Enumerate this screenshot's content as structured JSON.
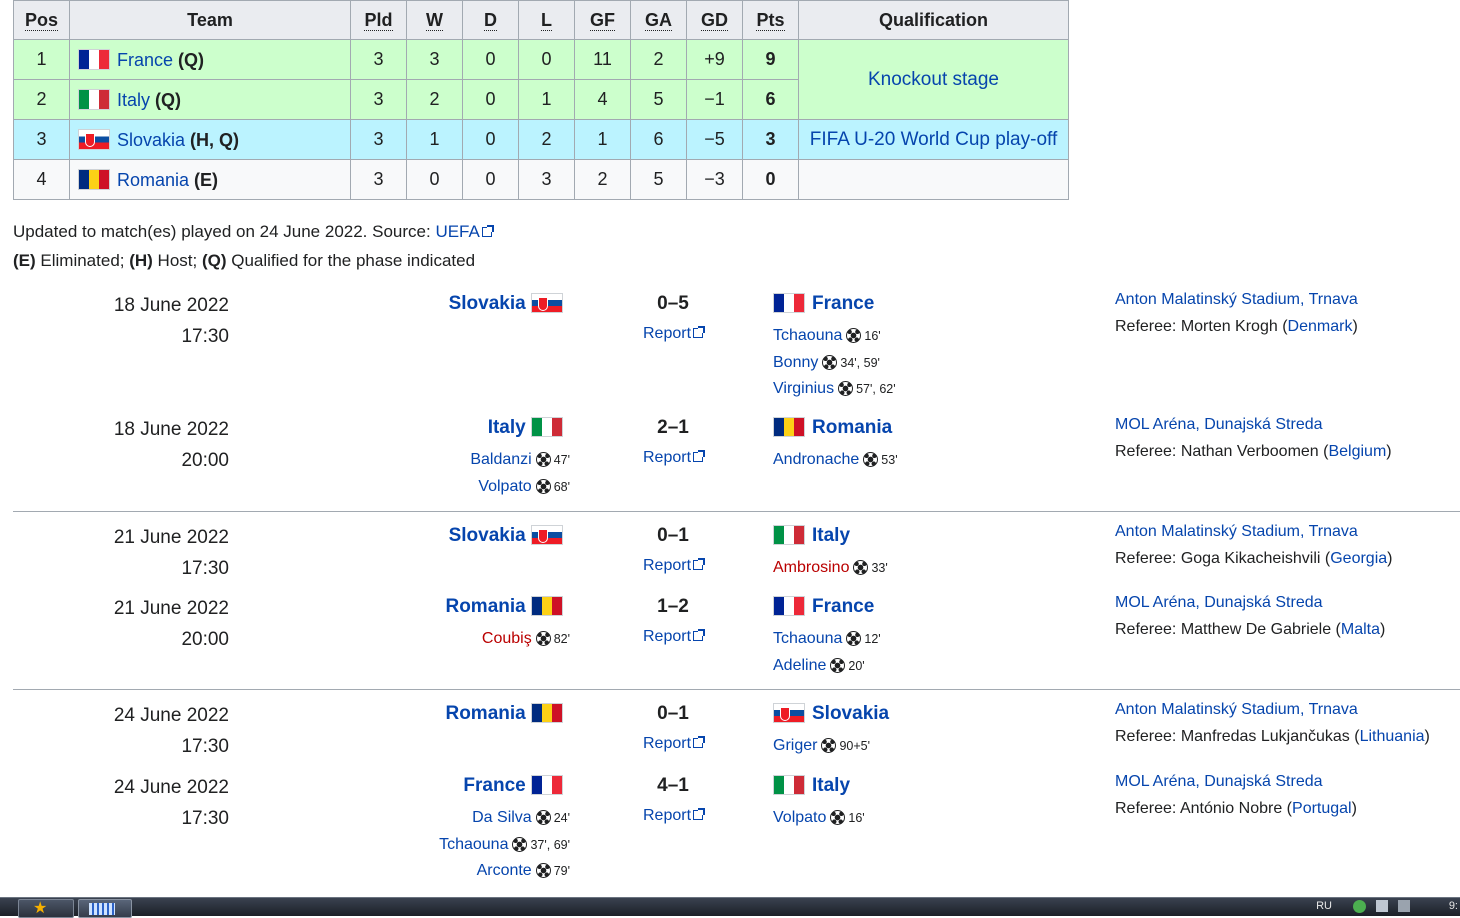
{
  "standings": {
    "headers": {
      "pos": "Pos",
      "team": "Team",
      "pld": "Pld",
      "w": "W",
      "d": "D",
      "l": "L",
      "gf": "GF",
      "ga": "GA",
      "gd": "GD",
      "pts": "Pts",
      "qual": "Qualification"
    },
    "rows": [
      {
        "pos": "1",
        "team": "France",
        "suffix": " (Q)",
        "pld": "3",
        "w": "3",
        "d": "0",
        "l": "0",
        "gf": "11",
        "ga": "2",
        "gd": "+9",
        "pts": "9"
      },
      {
        "pos": "2",
        "team": "Italy",
        "suffix": " (Q)",
        "pld": "3",
        "w": "2",
        "d": "0",
        "l": "1",
        "gf": "4",
        "ga": "5",
        "gd": "−1",
        "pts": "6"
      },
      {
        "pos": "3",
        "team": "Slovakia",
        "suffix": " (H, Q)",
        "pld": "3",
        "w": "1",
        "d": "0",
        "l": "2",
        "gf": "1",
        "ga": "6",
        "gd": "−5",
        "pts": "3"
      },
      {
        "pos": "4",
        "team": "Romania",
        "suffix": " (E)",
        "pld": "3",
        "w": "0",
        "d": "0",
        "l": "3",
        "gf": "2",
        "ga": "5",
        "gd": "−3",
        "pts": "0"
      }
    ],
    "qual_knockout": "Knockout stage",
    "qual_playoff": "FIFA U-20 World Cup play-off",
    "colors": {
      "advance": "#ccffcc",
      "playoff": "#bbf3ff",
      "header": "#eaecf0"
    }
  },
  "notes": {
    "updated_prefix": "Updated to match(es) played on 24 June 2022. Source: ",
    "source_link": "UEFA",
    "legend_e": "(E)",
    "legend_e_text": " Eliminated; ",
    "legend_h": "(H)",
    "legend_h_text": " Host; ",
    "legend_q": "(Q)",
    "legend_q_text": " Qualified for the phase indicated"
  },
  "matches": [
    {
      "date": "18 June 2022",
      "time": "17:30",
      "home": "Slovakia",
      "away": "France",
      "score": "0–5",
      "report": "Report",
      "home_goals": [],
      "away_goals": [
        {
          "player": "Tchaouna",
          "time": "16'"
        },
        {
          "player": "Bonny",
          "time": "34', 59'"
        },
        {
          "player": "Virginius",
          "time": "57', 62'"
        }
      ],
      "venue": "Anton Malatinský Stadium, Trnava",
      "ref_label": "Referee: ",
      "referee": "Morten Krogh",
      "ref_country": "Denmark"
    },
    {
      "date": "18 June 2022",
      "time": "20:00",
      "home": "Italy",
      "away": "Romania",
      "score": "2–1",
      "report": "Report",
      "home_goals": [
        {
          "player": "Baldanzi",
          "time": "47'"
        },
        {
          "player": "Volpato",
          "time": "68'"
        }
      ],
      "away_goals": [
        {
          "player": "Andronache",
          "time": "53'"
        }
      ],
      "venue": "MOL Aréna, Dunajská Streda",
      "ref_label": "Referee: ",
      "referee": "Nathan Verboomen",
      "ref_country": "Belgium"
    },
    {
      "date": "21 June 2022",
      "time": "17:30",
      "home": "Slovakia",
      "away": "Italy",
      "score": "0–1",
      "report": "Report",
      "home_goals": [],
      "away_goals": [
        {
          "player": "Ambrosino",
          "time": "33'"
        }
      ],
      "venue": "Anton Malatinský Stadium, Trnava",
      "ref_label": "Referee: ",
      "referee": "Goga Kikacheishvili",
      "ref_country": "Georgia"
    },
    {
      "date": "21 June 2022",
      "time": "20:00",
      "home": "Romania",
      "away": "France",
      "score": "1–2",
      "report": "Report",
      "home_goals": [
        {
          "player": "Coubiş",
          "time": "82'"
        }
      ],
      "away_goals": [
        {
          "player": "Tchaouna",
          "time": "12'"
        },
        {
          "player": "Adeline",
          "time": "20'"
        }
      ],
      "venue": "MOL Aréna, Dunajská Streda",
      "ref_label": "Referee: ",
      "referee": "Matthew De Gabriele",
      "ref_country": "Malta"
    },
    {
      "date": "24 June 2022",
      "time": "17:30",
      "home": "Romania",
      "away": "Slovakia",
      "score": "0–1",
      "report": "Report",
      "home_goals": [],
      "away_goals": [
        {
          "player": "Griger",
          "time": "90+5'"
        }
      ],
      "venue": "Anton Malatinský Stadium, Trnava",
      "ref_label": "Referee: ",
      "referee": "Manfredas Lukjančukas",
      "ref_country": "Lithuania"
    },
    {
      "date": "24 June 2022",
      "time": "17:30",
      "home": "France",
      "away": "Italy",
      "score": "4–1",
      "report": "Report",
      "home_goals": [
        {
          "player": "Da Silva",
          "time": "24'"
        },
        {
          "player": "Tchaouna",
          "time": "37', 69'"
        },
        {
          "player": "Arconte",
          "time": "79'"
        }
      ],
      "away_goals": [
        {
          "player": "Volpato",
          "time": "16'"
        }
      ],
      "venue": "MOL Aréna, Dunajská Streda",
      "ref_label": "Referee: ",
      "referee": "António Nobre",
      "ref_country": "Portugal"
    }
  ],
  "taskbar": {
    "lang": "RU",
    "clock": "9:"
  }
}
